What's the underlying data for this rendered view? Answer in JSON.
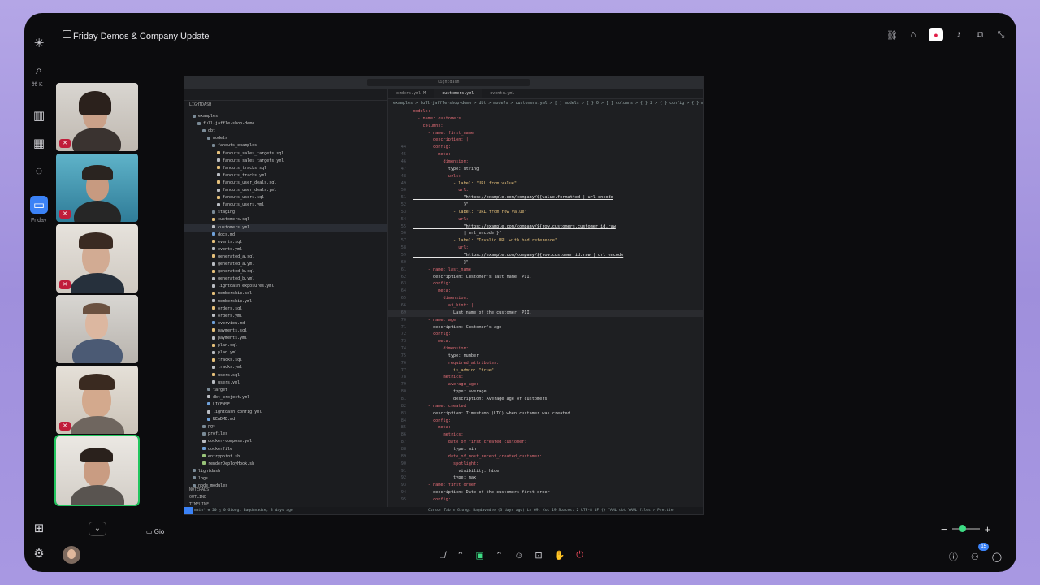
{
  "meeting": {
    "title": "Friday Demos & Company Update",
    "sharer_label": "Gio",
    "sidebar_active_label": "Friday",
    "search_shortcut": "⌘ K",
    "participant_count": "15"
  },
  "editor": {
    "search_placeholder": "lightdash",
    "explorer_title": "LIGHTDASH",
    "tabs": [
      {
        "label": "orders.yml M",
        "active": false
      },
      {
        "label": "customers.yml",
        "active": true
      },
      {
        "label": "events.yml",
        "active": false
      }
    ],
    "breadcrumb": "examples > full-jaffle-shop-demo > dbt > models > customers.yml > [ ] models > { } 0 > [ ] columns > { } 2 > { } config > { } meta > { } dimension",
    "tree": [
      {
        "label": "examples",
        "depth": 1,
        "type": "folder"
      },
      {
        "label": "full-jaffle-shop-demo",
        "depth": 2,
        "type": "folder"
      },
      {
        "label": "dbt",
        "depth": 3,
        "type": "folder"
      },
      {
        "label": "models",
        "depth": 4,
        "type": "folder"
      },
      {
        "label": "fanouts_examples",
        "depth": 5,
        "type": "folder"
      },
      {
        "label": "fanouts_sales_targets.sql",
        "depth": 6,
        "type": "sql"
      },
      {
        "label": "fanouts_sales_targets.yml",
        "depth": 6,
        "type": "yml"
      },
      {
        "label": "fanouts_tracks.sql",
        "depth": 6,
        "type": "sql"
      },
      {
        "label": "fanouts_tracks.yml",
        "depth": 6,
        "type": "yml"
      },
      {
        "label": "fanouts_user_deals.sql",
        "depth": 6,
        "type": "sql"
      },
      {
        "label": "fanouts_user_deals.yml",
        "depth": 6,
        "type": "yml"
      },
      {
        "label": "fanouts_users.sql",
        "depth": 6,
        "type": "sql"
      },
      {
        "label": "fanouts_users.yml",
        "depth": 6,
        "type": "yml"
      },
      {
        "label": "staging",
        "depth": 5,
        "type": "folder"
      },
      {
        "label": "customers.sql",
        "depth": 5,
        "type": "sql"
      },
      {
        "label": "customers.yml",
        "depth": 5,
        "type": "yml",
        "selected": true
      },
      {
        "label": "docs.md",
        "depth": 5,
        "type": "md"
      },
      {
        "label": "events.sql",
        "depth": 5,
        "type": "sql"
      },
      {
        "label": "events.yml",
        "depth": 5,
        "type": "yml"
      },
      {
        "label": "generated_a.sql",
        "depth": 5,
        "type": "sql"
      },
      {
        "label": "generated_a.yml",
        "depth": 5,
        "type": "yml"
      },
      {
        "label": "generated_b.sql",
        "depth": 5,
        "type": "sql"
      },
      {
        "label": "generated_b.yml",
        "depth": 5,
        "type": "yml"
      },
      {
        "label": "lightdash_exposures.yml",
        "depth": 5,
        "type": "yml"
      },
      {
        "label": "membership.sql",
        "depth": 5,
        "type": "sql"
      },
      {
        "label": "membership.yml",
        "depth": 5,
        "type": "yml"
      },
      {
        "label": "orders.sql",
        "depth": 5,
        "type": "sql"
      },
      {
        "label": "orders.yml",
        "depth": 5,
        "type": "yml"
      },
      {
        "label": "overview.md",
        "depth": 5,
        "type": "md"
      },
      {
        "label": "payments.sql",
        "depth": 5,
        "type": "sql"
      },
      {
        "label": "payments.yml",
        "depth": 5,
        "type": "yml"
      },
      {
        "label": "plan.sql",
        "depth": 5,
        "type": "sql"
      },
      {
        "label": "plan.yml",
        "depth": 5,
        "type": "yml"
      },
      {
        "label": "tracks.sql",
        "depth": 5,
        "type": "sql"
      },
      {
        "label": "tracks.yml",
        "depth": 5,
        "type": "yml"
      },
      {
        "label": "users.sql",
        "depth": 5,
        "type": "sql"
      },
      {
        "label": "users.yml",
        "depth": 5,
        "type": "yml"
      },
      {
        "label": "target",
        "depth": 4,
        "type": "folder"
      },
      {
        "label": "dbt_project.yml",
        "depth": 4,
        "type": "yml"
      },
      {
        "label": "LICENSE",
        "depth": 4,
        "type": "md"
      },
      {
        "label": "lightdash.config.yml",
        "depth": 4,
        "type": "yml"
      },
      {
        "label": "README.md",
        "depth": 4,
        "type": "md"
      },
      {
        "label": "pgs",
        "depth": 3,
        "type": "folder"
      },
      {
        "label": "profiles",
        "depth": 3,
        "type": "folder"
      },
      {
        "label": "docker-compose.yml",
        "depth": 3,
        "type": "yml"
      },
      {
        "label": "dockerfile",
        "depth": 3,
        "type": "md"
      },
      {
        "label": "entrypoint.sh",
        "depth": 3,
        "type": "sh"
      },
      {
        "label": "renderDeployHook.sh",
        "depth": 3,
        "type": "sh"
      },
      {
        "label": "lightdash",
        "depth": 1,
        "type": "folder"
      },
      {
        "label": "logs",
        "depth": 1,
        "type": "folder"
      },
      {
        "label": "node_modules",
        "depth": 1,
        "type": "folder"
      }
    ],
    "panels": [
      "NOTEPADS",
      "OUTLINE",
      "TIMELINE"
    ],
    "code": [
      {
        "n": "",
        "t": "models:",
        "cls": "k"
      },
      {
        "n": "",
        "t": "  - name: customers",
        "cls": "k"
      },
      {
        "n": "",
        "t": "    columns:",
        "cls": "k"
      },
      {
        "n": "",
        "t": "      - name: first_name",
        "cls": "k"
      },
      {
        "n": "",
        "t": "        description: |",
        "cls": "k"
      },
      {
        "n": "44",
        "t": "        config:",
        "cls": "k"
      },
      {
        "n": "45",
        "t": "          meta:",
        "cls": "k"
      },
      {
        "n": "46",
        "t": "            dimension:",
        "cls": "k"
      },
      {
        "n": "47",
        "t": "              type: string",
        "cls": "v"
      },
      {
        "n": "48",
        "t": "              urls:",
        "cls": "k"
      },
      {
        "n": "49",
        "t": "                - label: \"URL from value\"",
        "cls": "s"
      },
      {
        "n": "50",
        "t": "                  url:",
        "cls": "k"
      },
      {
        "n": "51",
        "t": "                    \"https://example.com/company/${value.formatted | url_encode",
        "cls": "u"
      },
      {
        "n": "52",
        "t": "                    }\"",
        "cls": "v"
      },
      {
        "n": "53",
        "t": "                - label: \"URL from row value\"",
        "cls": "s"
      },
      {
        "n": "54",
        "t": "                  url:",
        "cls": "k"
      },
      {
        "n": "55",
        "t": "                    \"https://example.com/company/${row.customers.customer_id.raw",
        "cls": "u"
      },
      {
        "n": "56",
        "t": "                    | url_encode }\"",
        "cls": "v"
      },
      {
        "n": "57",
        "t": "                - label: \"Invalid URL with bad reference\"",
        "cls": "s"
      },
      {
        "n": "58",
        "t": "                  url:",
        "cls": "k"
      },
      {
        "n": "59",
        "t": "                    \"https://example.com/company/${row.customer_id.raw | url_encode",
        "cls": "u"
      },
      {
        "n": "60",
        "t": "                    }\"",
        "cls": "v"
      },
      {
        "n": "61",
        "t": "      - name: last_name",
        "cls": "k"
      },
      {
        "n": "62",
        "t": "        description: Customer's last name. PII.",
        "cls": "v"
      },
      {
        "n": "63",
        "t": "        config:",
        "cls": "k"
      },
      {
        "n": "64",
        "t": "          meta:",
        "cls": "k"
      },
      {
        "n": "65",
        "t": "            dimension:",
        "cls": "k"
      },
      {
        "n": "66",
        "t": "              ai_hint: |",
        "cls": "k"
      },
      {
        "n": "69",
        "t": "                Last name of the customer. PII.",
        "cls": "v",
        "current": true
      },
      {
        "n": "70",
        "t": "      - name: age",
        "cls": "k"
      },
      {
        "n": "71",
        "t": "        description: Customer's age",
        "cls": "v"
      },
      {
        "n": "72",
        "t": "        config:",
        "cls": "k"
      },
      {
        "n": "73",
        "t": "          meta:",
        "cls": "k"
      },
      {
        "n": "74",
        "t": "            dimension:",
        "cls": "k"
      },
      {
        "n": "75",
        "t": "              type: number",
        "cls": "v"
      },
      {
        "n": "76",
        "t": "              required_attributes:",
        "cls": "k"
      },
      {
        "n": "77",
        "t": "                is_admin: \"true\"",
        "cls": "s"
      },
      {
        "n": "78",
        "t": "            metrics:",
        "cls": "k"
      },
      {
        "n": "79",
        "t": "              average_age:",
        "cls": "k"
      },
      {
        "n": "80",
        "t": "                type: average",
        "cls": "v"
      },
      {
        "n": "81",
        "t": "                description: Average age of customers",
        "cls": "v"
      },
      {
        "n": "82",
        "t": "      - name: created",
        "cls": "k"
      },
      {
        "n": "83",
        "t": "        description: Timestamp (UTC) when customer was created",
        "cls": "v"
      },
      {
        "n": "84",
        "t": "        config:",
        "cls": "k"
      },
      {
        "n": "85",
        "t": "          meta:",
        "cls": "k"
      },
      {
        "n": "86",
        "t": "            metrics:",
        "cls": "k"
      },
      {
        "n": "87",
        "t": "              date_of_first_created_customer:",
        "cls": "k"
      },
      {
        "n": "88",
        "t": "                type: min",
        "cls": "v"
      },
      {
        "n": "89",
        "t": "              date_of_most_recent_created_customer:",
        "cls": "k"
      },
      {
        "n": "90",
        "t": "                spotlight:",
        "cls": "k"
      },
      {
        "n": "91",
        "t": "                  visibility: hide",
        "cls": "v"
      },
      {
        "n": "92",
        "t": "                type: max",
        "cls": "v"
      },
      {
        "n": "93",
        "t": "      - name: first_order",
        "cls": "k"
      },
      {
        "n": "94",
        "t": "        description: Date of the customers first order",
        "cls": "v"
      },
      {
        "n": "95",
        "t": "        config:",
        "cls": "k"
      }
    ],
    "status_left": "main*   ⊗ 20 △ 0   Giorgi Bagdavadze, 3 days ago",
    "status_right": "Cursor Tab   ⊙ Giorgi Bagdavadze (3 days ago)   Ln 69, Col 19   Spaces: 2   UTF-8   LF   {} YAML   dbt YAML files   ✓ Prettier"
  },
  "colors": {
    "accent": "#3b82f6",
    "speaking": "#22c55e",
    "leave": "#f04b5c"
  }
}
